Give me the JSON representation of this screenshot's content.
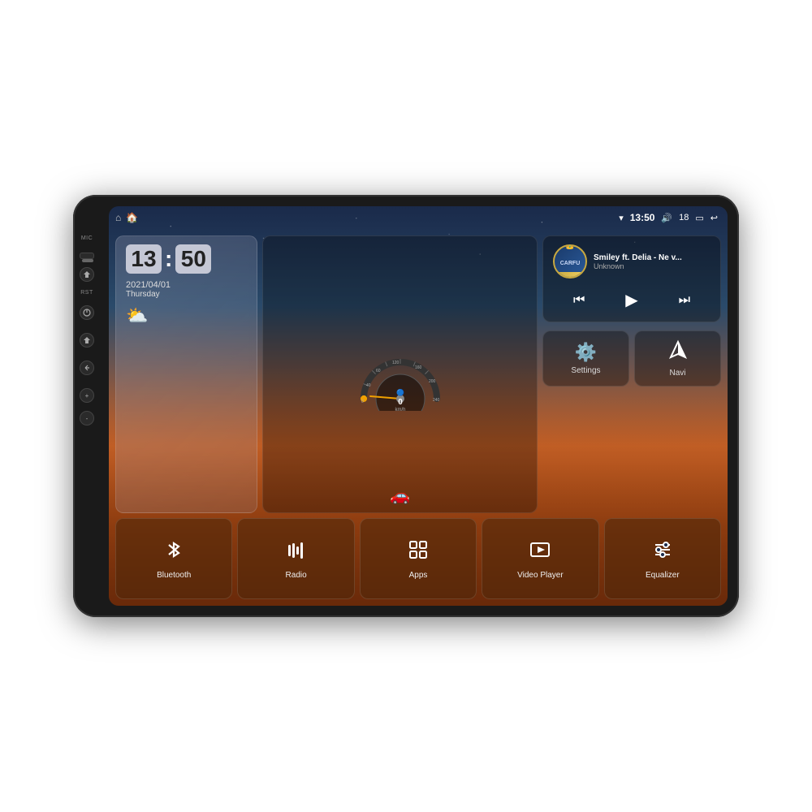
{
  "device": {
    "mic_label": "MIC",
    "rst_label": "RST"
  },
  "status_bar": {
    "wifi_icon": "wifi",
    "time": "13:50",
    "volume_icon": "volume",
    "volume_level": "18",
    "battery_icon": "battery",
    "back_icon": "back"
  },
  "clock": {
    "hours": "13",
    "minutes": "50",
    "date": "2021/04/01",
    "day": "Thursday",
    "weather_icon": "⛅"
  },
  "speedometer": {
    "speed": "0",
    "unit": "km/h"
  },
  "music": {
    "logo_text": "CARFU",
    "title": "Smiley ft. Delia - Ne v...",
    "artist": "Unknown",
    "prev_icon": "⏮",
    "play_icon": "▶",
    "next_icon": "⏭"
  },
  "widgets": {
    "settings_label": "Settings",
    "navi_label": "Navi"
  },
  "bottom_apps": [
    {
      "id": "bluetooth",
      "label": "Bluetooth",
      "icon": "bluetooth"
    },
    {
      "id": "radio",
      "label": "Radio",
      "icon": "radio"
    },
    {
      "id": "apps",
      "label": "Apps",
      "icon": "apps"
    },
    {
      "id": "video_player",
      "label": "Video Player",
      "icon": "video"
    },
    {
      "id": "equalizer",
      "label": "Equalizer",
      "icon": "equalizer"
    }
  ]
}
